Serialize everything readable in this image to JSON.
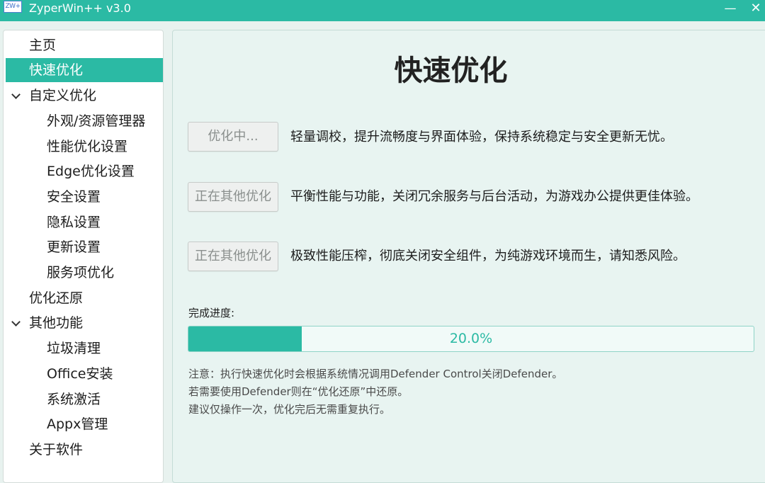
{
  "window": {
    "icon_text": "ZW+",
    "title": "ZyperWin++ v3.0",
    "minimize_glyph": "—",
    "close_glyph": "✕"
  },
  "sidebar": {
    "items": [
      {
        "label": "主页",
        "level": 0,
        "active": false,
        "expandable": false
      },
      {
        "label": "快速优化",
        "level": 0,
        "active": true,
        "expandable": false
      },
      {
        "label": "自定义优化",
        "level": 0,
        "active": false,
        "expandable": true
      },
      {
        "label": "外观/资源管理器",
        "level": 1,
        "active": false,
        "expandable": false
      },
      {
        "label": "性能优化设置",
        "level": 1,
        "active": false,
        "expandable": false
      },
      {
        "label": "Edge优化设置",
        "level": 1,
        "active": false,
        "expandable": false
      },
      {
        "label": "安全设置",
        "level": 1,
        "active": false,
        "expandable": false
      },
      {
        "label": "隐私设置",
        "level": 1,
        "active": false,
        "expandable": false
      },
      {
        "label": "更新设置",
        "level": 1,
        "active": false,
        "expandable": false
      },
      {
        "label": "服务项优化",
        "level": 1,
        "active": false,
        "expandable": false
      },
      {
        "label": "优化还原",
        "level": 0,
        "active": false,
        "expandable": false
      },
      {
        "label": "其他功能",
        "level": 0,
        "active": false,
        "expandable": true
      },
      {
        "label": "垃圾清理",
        "level": 1,
        "active": false,
        "expandable": false
      },
      {
        "label": "Office安装",
        "level": 1,
        "active": false,
        "expandable": false
      },
      {
        "label": "系统激活",
        "level": 1,
        "active": false,
        "expandable": false
      },
      {
        "label": "Appx管理",
        "level": 1,
        "active": false,
        "expandable": false
      },
      {
        "label": "关于软件",
        "level": 0,
        "active": false,
        "expandable": false
      }
    ]
  },
  "main": {
    "title": "快速优化",
    "options": [
      {
        "button": "优化中...",
        "description": "轻量调校，提升流畅度与界面体验，保持系统稳定与安全更新无忧。"
      },
      {
        "button": "正在其他优化",
        "description": "平衡性能与功能，关闭冗余服务与后台活动，为游戏办公提供更佳体验。"
      },
      {
        "button": "正在其他优化",
        "description": "极致性能压榨，彻底关闭安全组件，为纯游戏环境而生，请知悉风险。"
      }
    ],
    "progress": {
      "label": "完成进度:",
      "value": 0.2,
      "text": "20.0%"
    },
    "notes": [
      "注意：执行快速优化时会根据系统情况调用Defender Control关闭Defender。",
      "若需要使用Defender则在“优化还原”中还原。",
      "建议仅操作一次，优化完后无需重复执行。"
    ]
  },
  "colors": {
    "accent": "#2bbaa4",
    "panel_background": "#e8f4f1",
    "sidebar_background": "#ffffff",
    "disabled_button_text": "#8a8f8d"
  },
  "icons": {
    "app": "zyperwin-logo-icon",
    "expand": "chevron-down-icon",
    "minimize": "minimize-icon",
    "close": "close-icon"
  }
}
